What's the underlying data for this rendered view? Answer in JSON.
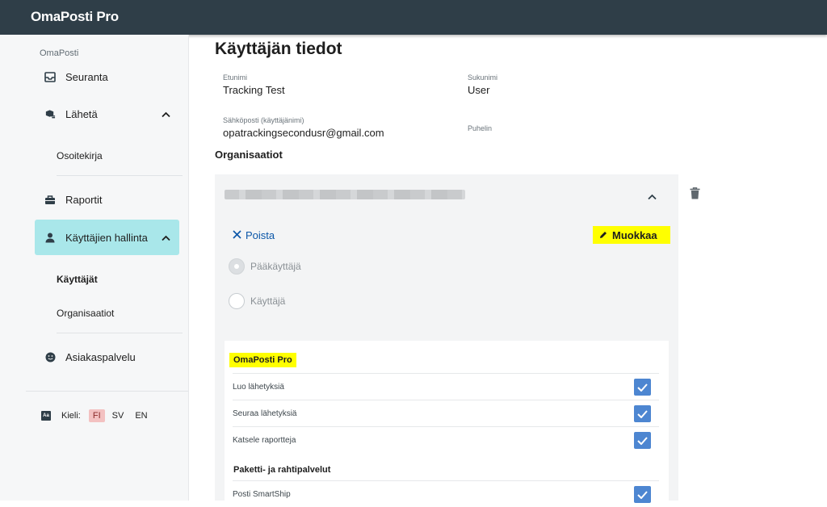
{
  "app": {
    "brand": "OmaPosti Pro"
  },
  "sidebar": {
    "section_label": "OmaPosti",
    "items": [
      {
        "label": "Seuranta",
        "icon": "inbox-icon"
      },
      {
        "label": "Lähetä",
        "icon": "parcel-icon",
        "expanded": true
      },
      {
        "label": "Osoitekirja",
        "sub": true
      },
      {
        "label": "Raportit",
        "icon": "briefcase-icon"
      },
      {
        "label": "Käyttäjien hallinta",
        "icon": "user-icon",
        "expanded": true,
        "active": true
      },
      {
        "label": "Käyttäjät",
        "sub": true,
        "active": true
      },
      {
        "label": "Organisaatiot",
        "sub": true
      },
      {
        "label": "Asiakaspalvelu",
        "icon": "smile-icon"
      }
    ],
    "language": {
      "label": "Kieli:",
      "options": [
        "FI",
        "SV",
        "EN"
      ],
      "selected": "FI"
    }
  },
  "main": {
    "title": "Käyttäjän tiedot",
    "fields": {
      "first_name": {
        "label": "Etunimi",
        "value": "Tracking Test"
      },
      "last_name": {
        "label": "Sukunimi",
        "value": "User"
      },
      "email": {
        "label": "Sähköposti (käyttäjänimi)",
        "value": "opatrackingsecondusr@gmail.com"
      },
      "phone": {
        "label": "Puhelin",
        "value": ""
      }
    },
    "organisations_heading": "Organisaatiot",
    "org": {
      "remove_label": "Poista",
      "edit_label": "Muokkaa",
      "roles": [
        {
          "label": "Pääkäyttäjä",
          "selected": true
        },
        {
          "label": "Käyttäjä",
          "selected": false
        }
      ],
      "permission_groups": [
        {
          "title": "OmaPosti Pro",
          "items": [
            {
              "label": "Luo lähetyksiä",
              "checked": true
            },
            {
              "label": "Seuraa lähetyksiä",
              "checked": true
            },
            {
              "label": "Katsele raportteja",
              "checked": true
            }
          ]
        },
        {
          "title": "Paketti- ja rahtipalvelut",
          "items": [
            {
              "label": "Posti SmartShip",
              "checked": true
            }
          ]
        }
      ]
    }
  },
  "colors": {
    "topbar": "#2f3e48",
    "active_nav": "#a9e7ea",
    "link": "#0a56a8",
    "checkbox": "#4d86d1",
    "highlight": "#ffff00"
  }
}
